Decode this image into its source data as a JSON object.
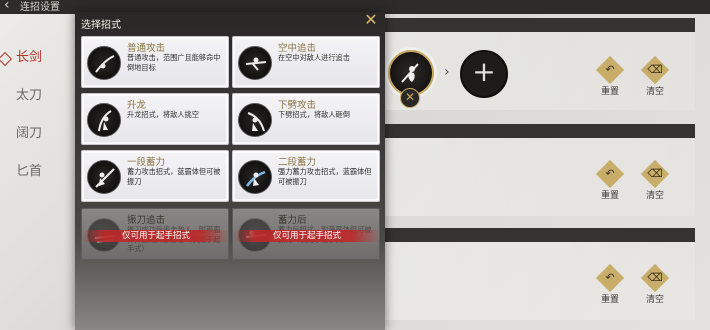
{
  "page": {
    "title": "连招设置",
    "weapons": [
      {
        "label": "长剑",
        "active": true
      },
      {
        "label": "太刀",
        "active": false
      },
      {
        "label": "阔刀",
        "active": false
      },
      {
        "label": "匕首",
        "active": false
      }
    ]
  },
  "combo_panels": [
    {
      "reset_label": "重置",
      "clear_label": "清空"
    },
    {
      "reset_label": "重置",
      "clear_label": "清空"
    },
    {
      "reset_label": "重置",
      "clear_label": "清空"
    }
  ],
  "modal": {
    "title": "选择招式",
    "skills": [
      {
        "name": "普通攻击",
        "desc": "普通攻击，范围广且能够命中倒地目标",
        "disabled": false
      },
      {
        "name": "空中追击",
        "desc": "在空中对敌人进行追击",
        "disabled": false
      },
      {
        "name": "升龙",
        "desc": "升龙招式，将敌人挑空",
        "disabled": false
      },
      {
        "name": "下劈攻击",
        "desc": "下劈招式，将敌人砸倒",
        "disabled": false
      },
      {
        "name": "一段蓄力",
        "desc": "蓄力攻击招式，蓝霸体但可被振刀",
        "disabled": false
      },
      {
        "name": "二段蓄力",
        "desc": "强力蓄力攻击招式，蓝霸体但可被振刀",
        "disabled": false
      },
      {
        "name": "振刀追击",
        "desc": "振刀成功后追击敌人，附带霸体并造成高额伤害（仅用于起手式）",
        "disabled": true,
        "restriction": "仅可用于起手招式"
      },
      {
        "name": "蓄力后",
        "desc": "蓄力后招式，附带霸体但可被振刀（仅用于起手式）",
        "disabled": true,
        "restriction": "仅可用于起手招式"
      }
    ]
  },
  "icons": {
    "close": "close-x-icon",
    "back": "back-arrow-icon",
    "add": "plus-icon",
    "remove": "remove-x-icon",
    "reset": "undo-icon",
    "clear": "trash-icon"
  },
  "colors": {
    "accent_gold": "#c9a862",
    "active_red": "#b3342a",
    "restriction_red": "#be2828"
  }
}
